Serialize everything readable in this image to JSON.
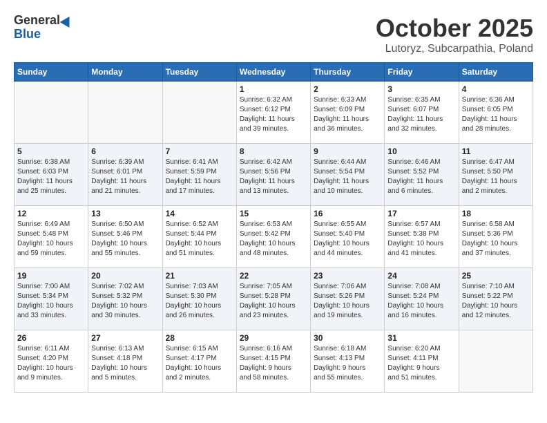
{
  "logo": {
    "line1": "General",
    "line2": "Blue"
  },
  "title": "October 2025",
  "location": "Lutoryz, Subcarpathia, Poland",
  "weekdays": [
    "Sunday",
    "Monday",
    "Tuesday",
    "Wednesday",
    "Thursday",
    "Friday",
    "Saturday"
  ],
  "weeks": [
    [
      {
        "day": "",
        "info": ""
      },
      {
        "day": "",
        "info": ""
      },
      {
        "day": "",
        "info": ""
      },
      {
        "day": "1",
        "info": "Sunrise: 6:32 AM\nSunset: 6:12 PM\nDaylight: 11 hours\nand 39 minutes."
      },
      {
        "day": "2",
        "info": "Sunrise: 6:33 AM\nSunset: 6:09 PM\nDaylight: 11 hours\nand 36 minutes."
      },
      {
        "day": "3",
        "info": "Sunrise: 6:35 AM\nSunset: 6:07 PM\nDaylight: 11 hours\nand 32 minutes."
      },
      {
        "day": "4",
        "info": "Sunrise: 6:36 AM\nSunset: 6:05 PM\nDaylight: 11 hours\nand 28 minutes."
      }
    ],
    [
      {
        "day": "5",
        "info": "Sunrise: 6:38 AM\nSunset: 6:03 PM\nDaylight: 11 hours\nand 25 minutes."
      },
      {
        "day": "6",
        "info": "Sunrise: 6:39 AM\nSunset: 6:01 PM\nDaylight: 11 hours\nand 21 minutes."
      },
      {
        "day": "7",
        "info": "Sunrise: 6:41 AM\nSunset: 5:59 PM\nDaylight: 11 hours\nand 17 minutes."
      },
      {
        "day": "8",
        "info": "Sunrise: 6:42 AM\nSunset: 5:56 PM\nDaylight: 11 hours\nand 13 minutes."
      },
      {
        "day": "9",
        "info": "Sunrise: 6:44 AM\nSunset: 5:54 PM\nDaylight: 11 hours\nand 10 minutes."
      },
      {
        "day": "10",
        "info": "Sunrise: 6:46 AM\nSunset: 5:52 PM\nDaylight: 11 hours\nand 6 minutes."
      },
      {
        "day": "11",
        "info": "Sunrise: 6:47 AM\nSunset: 5:50 PM\nDaylight: 11 hours\nand 2 minutes."
      }
    ],
    [
      {
        "day": "12",
        "info": "Sunrise: 6:49 AM\nSunset: 5:48 PM\nDaylight: 10 hours\nand 59 minutes."
      },
      {
        "day": "13",
        "info": "Sunrise: 6:50 AM\nSunset: 5:46 PM\nDaylight: 10 hours\nand 55 minutes."
      },
      {
        "day": "14",
        "info": "Sunrise: 6:52 AM\nSunset: 5:44 PM\nDaylight: 10 hours\nand 51 minutes."
      },
      {
        "day": "15",
        "info": "Sunrise: 6:53 AM\nSunset: 5:42 PM\nDaylight: 10 hours\nand 48 minutes."
      },
      {
        "day": "16",
        "info": "Sunrise: 6:55 AM\nSunset: 5:40 PM\nDaylight: 10 hours\nand 44 minutes."
      },
      {
        "day": "17",
        "info": "Sunrise: 6:57 AM\nSunset: 5:38 PM\nDaylight: 10 hours\nand 41 minutes."
      },
      {
        "day": "18",
        "info": "Sunrise: 6:58 AM\nSunset: 5:36 PM\nDaylight: 10 hours\nand 37 minutes."
      }
    ],
    [
      {
        "day": "19",
        "info": "Sunrise: 7:00 AM\nSunset: 5:34 PM\nDaylight: 10 hours\nand 33 minutes."
      },
      {
        "day": "20",
        "info": "Sunrise: 7:02 AM\nSunset: 5:32 PM\nDaylight: 10 hours\nand 30 minutes."
      },
      {
        "day": "21",
        "info": "Sunrise: 7:03 AM\nSunset: 5:30 PM\nDaylight: 10 hours\nand 26 minutes."
      },
      {
        "day": "22",
        "info": "Sunrise: 7:05 AM\nSunset: 5:28 PM\nDaylight: 10 hours\nand 23 minutes."
      },
      {
        "day": "23",
        "info": "Sunrise: 7:06 AM\nSunset: 5:26 PM\nDaylight: 10 hours\nand 19 minutes."
      },
      {
        "day": "24",
        "info": "Sunrise: 7:08 AM\nSunset: 5:24 PM\nDaylight: 10 hours\nand 16 minutes."
      },
      {
        "day": "25",
        "info": "Sunrise: 7:10 AM\nSunset: 5:22 PM\nDaylight: 10 hours\nand 12 minutes."
      }
    ],
    [
      {
        "day": "26",
        "info": "Sunrise: 6:11 AM\nSunset: 4:20 PM\nDaylight: 10 hours\nand 9 minutes."
      },
      {
        "day": "27",
        "info": "Sunrise: 6:13 AM\nSunset: 4:18 PM\nDaylight: 10 hours\nand 5 minutes."
      },
      {
        "day": "28",
        "info": "Sunrise: 6:15 AM\nSunset: 4:17 PM\nDaylight: 10 hours\nand 2 minutes."
      },
      {
        "day": "29",
        "info": "Sunrise: 6:16 AM\nSunset: 4:15 PM\nDaylight: 9 hours\nand 58 minutes."
      },
      {
        "day": "30",
        "info": "Sunrise: 6:18 AM\nSunset: 4:13 PM\nDaylight: 9 hours\nand 55 minutes."
      },
      {
        "day": "31",
        "info": "Sunrise: 6:20 AM\nSunset: 4:11 PM\nDaylight: 9 hours\nand 51 minutes."
      },
      {
        "day": "",
        "info": ""
      }
    ]
  ]
}
